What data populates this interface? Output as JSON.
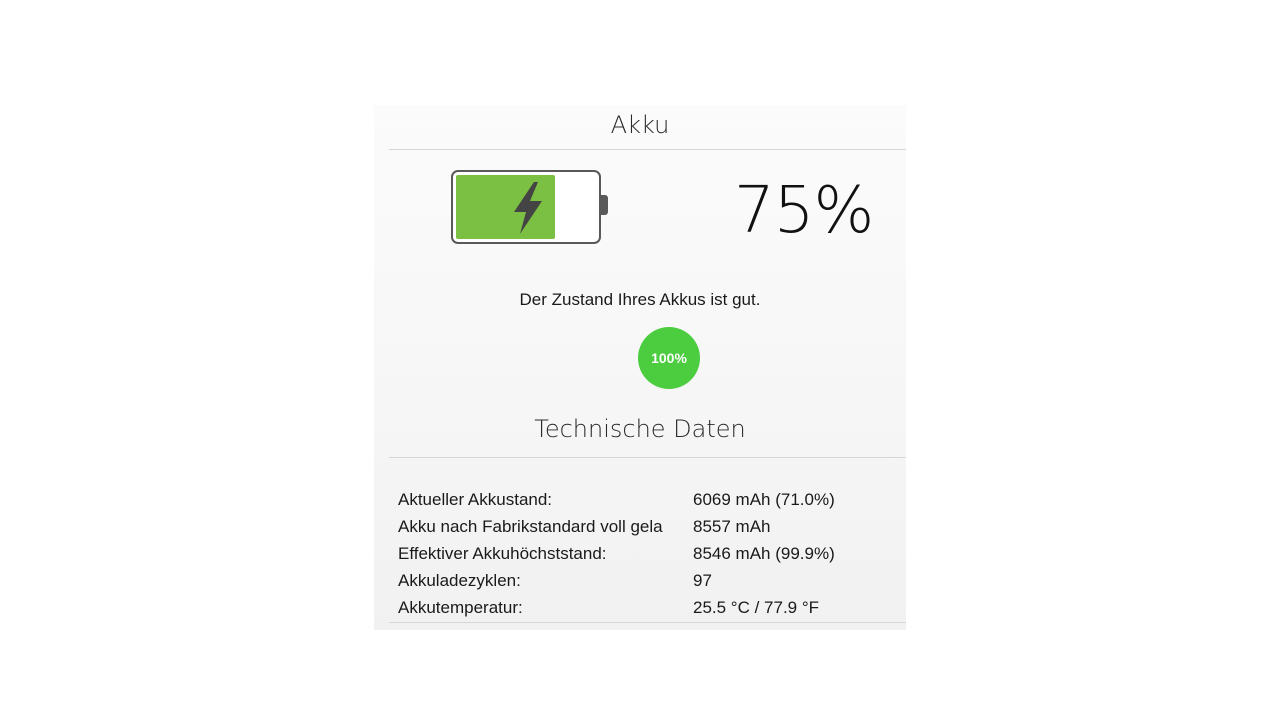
{
  "header": {
    "title": "Akku"
  },
  "battery": {
    "fill_fraction": 0.71,
    "fill_color": "#7bc043",
    "outline_color": "#595959",
    "icon": "lightning-bolt-icon",
    "percent_text": "75%"
  },
  "health": {
    "message": "Der Zustand Ihres Akkus ist gut.",
    "badge": "100%",
    "badge_color": "#4ccc3f"
  },
  "tech": {
    "title": "Technische Daten",
    "rows": [
      {
        "label": "Aktueller Akkustand:",
        "value": "6069 mAh (71.0%)"
      },
      {
        "label": "Akku nach Fabrikstandard voll gela",
        "value": "8557 mAh"
      },
      {
        "label": "Effektiver Akkuhöchststand:",
        "value": "8546 mAh (99.9%)"
      },
      {
        "label": "Akkuladezyklen:",
        "value": "97"
      },
      {
        "label": "Akkutemperatur:",
        "value": "25.5 °C / 77.9 °F"
      }
    ]
  }
}
